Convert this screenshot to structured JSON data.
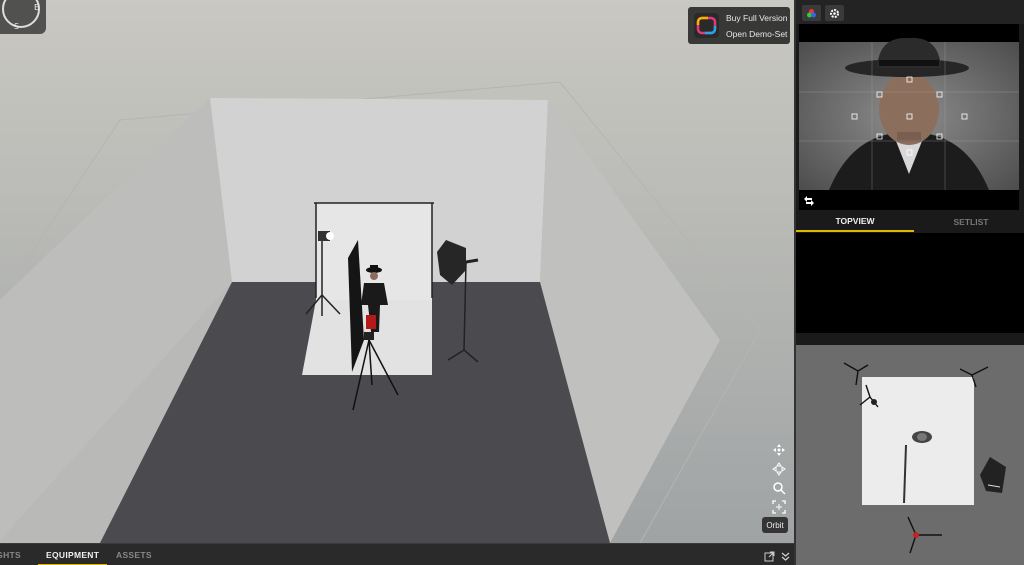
{
  "compass": {
    "north": "",
    "east": "E",
    "south": "S"
  },
  "promo": {
    "buy_label": "Buy Full Version",
    "demo_label": "Open Demo-Set"
  },
  "tools": {
    "orbit_label": "Orbit"
  },
  "bottom_tabs": [
    {
      "label": "LIGHTS",
      "active": false
    },
    {
      "label": "EQUIPMENT",
      "active": true
    },
    {
      "label": "ASSETS",
      "active": false
    }
  ],
  "right_tabs": [
    {
      "label": "TOPVIEW",
      "active": true
    },
    {
      "label": "SETLIST",
      "active": false
    }
  ],
  "colors": {
    "accent": "#e2b600",
    "panel": "#1a1a1a",
    "viewport_sky": "#c9c8c2"
  },
  "icons": [
    "compass-icon",
    "app-logo-icon",
    "color-wheel-icon",
    "gear-icon",
    "move-icon",
    "pan-icon",
    "zoom-icon",
    "frame-icon",
    "swap-icon",
    "popout-icon",
    "collapse-icon"
  ]
}
